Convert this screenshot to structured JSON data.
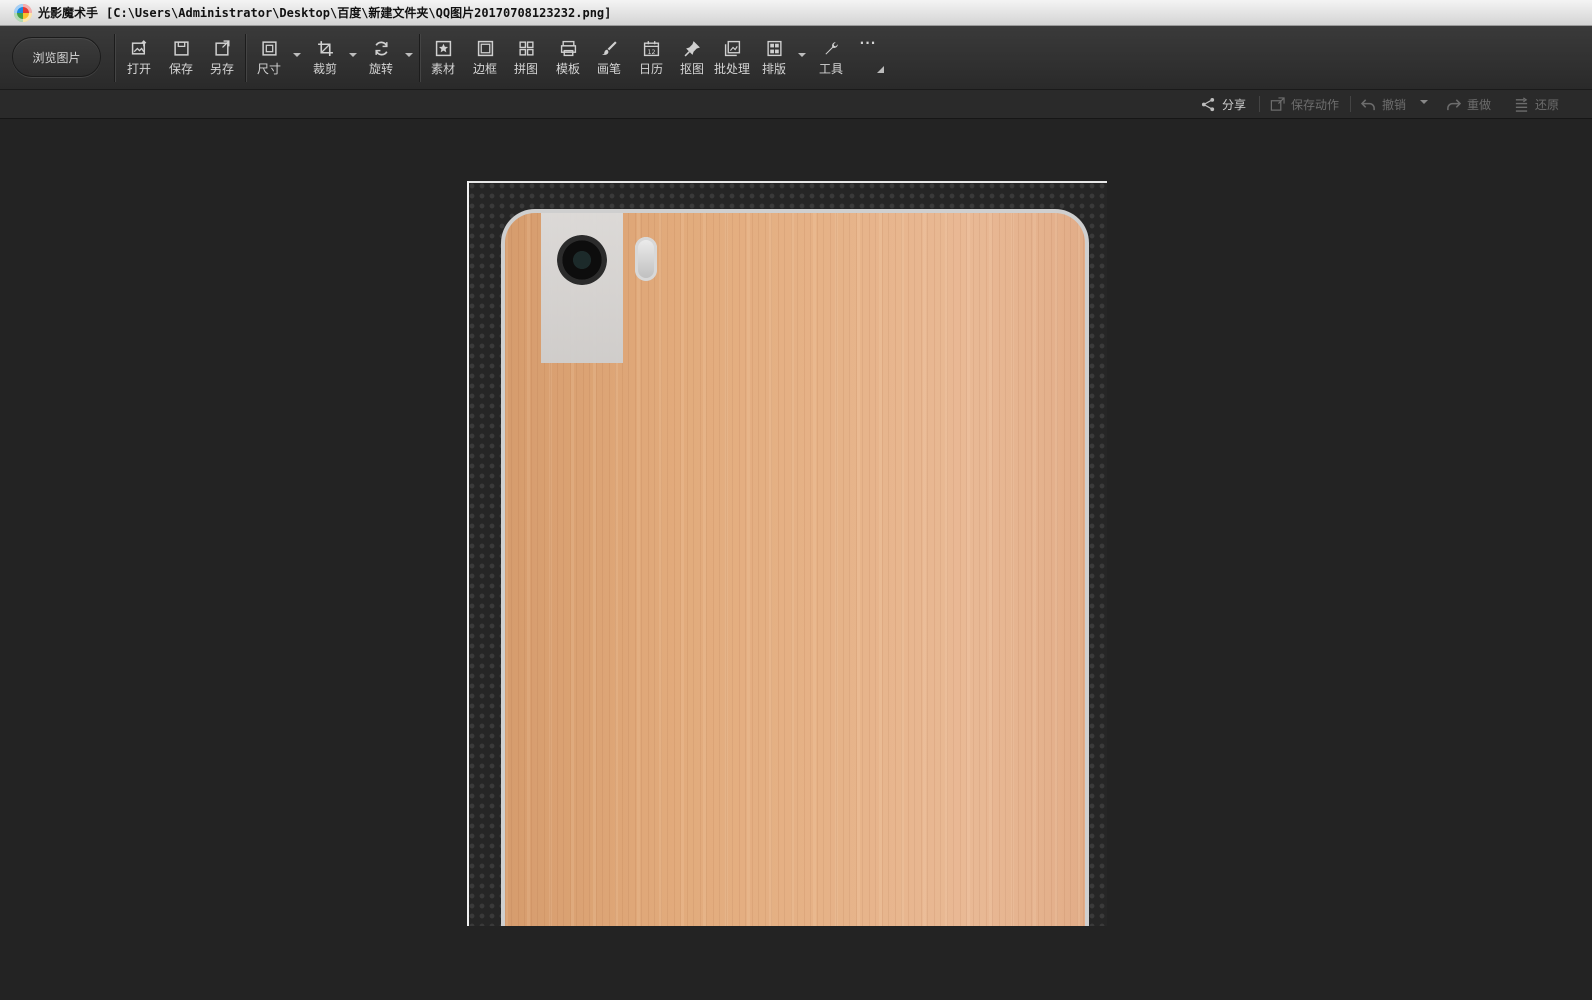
{
  "window": {
    "app_name": "光影魔术手",
    "file_path": "[C:\\Users\\Administrator\\Desktop\\百度\\新建文件夹\\QQ图片20170708123232.png]"
  },
  "toolbar": {
    "browse_label": "浏览图片",
    "tools": [
      {
        "label": "打开",
        "icon": "open-image-icon"
      },
      {
        "label": "保存",
        "icon": "save-icon"
      },
      {
        "label": "另存",
        "icon": "save-as-icon"
      },
      {
        "label": "尺寸",
        "icon": "resize-icon"
      },
      {
        "label": "裁剪",
        "icon": "crop-icon"
      },
      {
        "label": "旋转",
        "icon": "rotate-icon"
      },
      {
        "label": "素材",
        "icon": "material-icon"
      },
      {
        "label": "边框",
        "icon": "border-icon"
      },
      {
        "label": "拼图",
        "icon": "collage-icon"
      },
      {
        "label": "模板",
        "icon": "template-icon"
      },
      {
        "label": "画笔",
        "icon": "brush-icon"
      },
      {
        "label": "日历",
        "icon": "calendar-icon"
      },
      {
        "label": "抠图",
        "icon": "cutout-icon"
      },
      {
        "label": "批处理",
        "icon": "batch-icon"
      },
      {
        "label": "排版",
        "icon": "layout-icon"
      },
      {
        "label": "工具",
        "icon": "wrench-icon"
      }
    ],
    "more_label": "···",
    "calendar_day": "12"
  },
  "actions": {
    "share": "分享",
    "save_action": "保存动作",
    "undo": "撤销",
    "redo": "重做",
    "restore": "还原"
  },
  "colors": {
    "background": "#232323",
    "toolbar": "#333333",
    "text_enabled": "#cfcfcf",
    "text_disabled": "#6d6d6d"
  }
}
